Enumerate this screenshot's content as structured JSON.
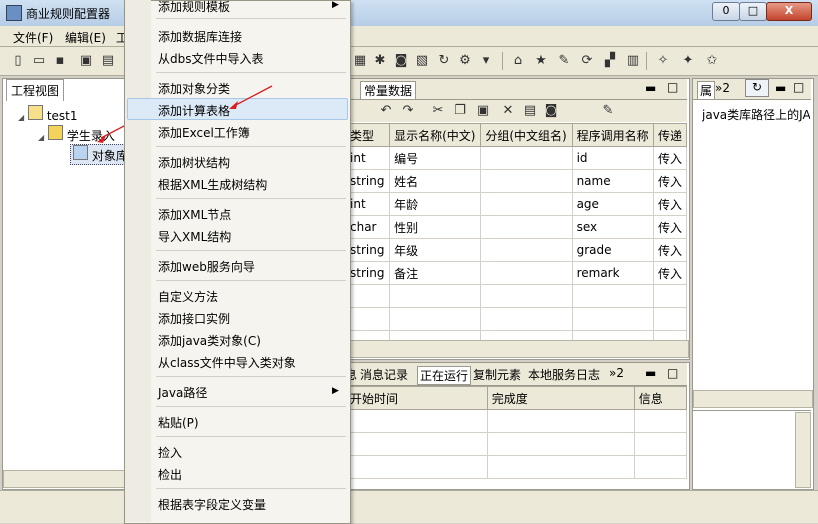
{
  "window": {
    "title": "商业规则配置器",
    "min_label": "0",
    "max_label": "□",
    "close_label": "X"
  },
  "menubar": {
    "file": "文件(F)",
    "edit": "编辑(E)",
    "more": "工"
  },
  "left_panel": {
    "tab": "工程视图",
    "tree": [
      {
        "label": "test1",
        "toggle": "◢"
      },
      {
        "label": "学生录入",
        "toggle": "◢"
      },
      {
        "label": "对象库"
      }
    ]
  },
  "center": {
    "tabs": [
      "常量数据"
    ],
    "columns": [
      "类型",
      "显示名称(中文)",
      "分组(中文组名)",
      "程序调用名称",
      "传递"
    ],
    "rows": [
      [
        "int",
        "编号",
        "",
        "id",
        "传入"
      ],
      [
        "string",
        "姓名",
        "",
        "name",
        "传入"
      ],
      [
        "int",
        "年龄",
        "",
        "age",
        "传入"
      ],
      [
        "char",
        "性别",
        "",
        "sex",
        "传入"
      ],
      [
        "string",
        "年级",
        "",
        "grade",
        "传入"
      ],
      [
        "string",
        "备注",
        "",
        "remark",
        "传入"
      ]
    ]
  },
  "bottom": {
    "tabs": [
      "息",
      "消息记录",
      "正在运行",
      "复制元素",
      "本地服务日志",
      "»2"
    ],
    "columns": [
      "开始时间",
      "完成度",
      "信息"
    ]
  },
  "right": {
    "tab": "属",
    "tab_more": "»2",
    "path_text": "java类库路径上的JA"
  },
  "context_menu": {
    "items": [
      {
        "label": "添加规则模板",
        "submenu": true
      },
      {
        "sep": true
      },
      {
        "label": "添加数据库连接"
      },
      {
        "label": "从dbs文件中导入表"
      },
      {
        "sep": true
      },
      {
        "label": "添加对象分类"
      },
      {
        "label": "添加计算表格",
        "highlighted": true
      },
      {
        "label": "添加Excel工作簿"
      },
      {
        "sep": true
      },
      {
        "label": "添加树状结构"
      },
      {
        "label": "根据XML生成树结构"
      },
      {
        "sep": true
      },
      {
        "label": "添加XML节点"
      },
      {
        "label": "导入XML结构"
      },
      {
        "sep": true
      },
      {
        "label": "添加web服务向导"
      },
      {
        "sep": true
      },
      {
        "label": "自定义方法"
      },
      {
        "label": "添加接口实例"
      },
      {
        "label": "添加java类对象(C)"
      },
      {
        "label": "从class文件中导入类对象"
      },
      {
        "sep": true
      },
      {
        "label": "Java路径",
        "submenu": true
      },
      {
        "sep": true
      },
      {
        "label": "粘贴(P)"
      },
      {
        "sep": true
      },
      {
        "label": "捡入"
      },
      {
        "label": "检出"
      },
      {
        "sep": true
      },
      {
        "label": "根据表字段定义变量"
      }
    ]
  },
  "colors": {
    "accent": "#d81e1e",
    "menu_highlight": "#dce9f6",
    "titlebar": "#c3d7ee"
  }
}
